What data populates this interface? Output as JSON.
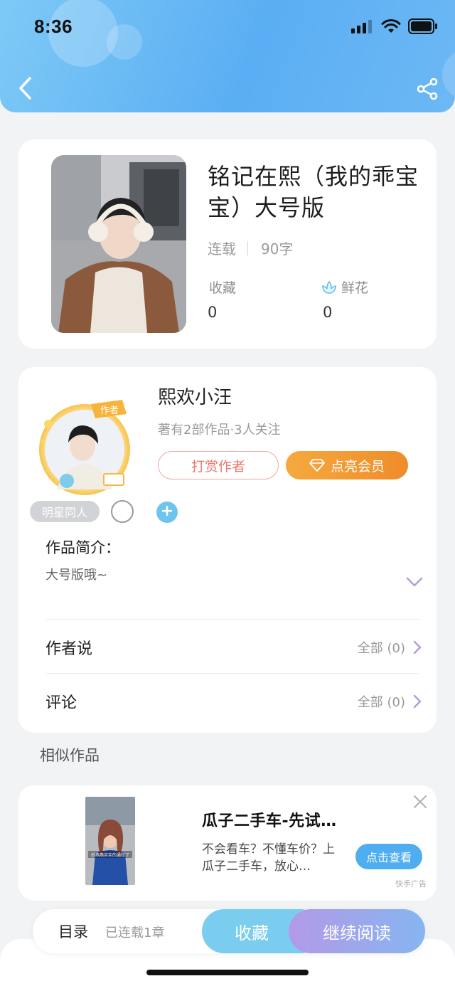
{
  "status_bar": {
    "time": "8:36"
  },
  "book": {
    "title": "铭记在熙（我的乖宝宝）大号版",
    "status": "连载",
    "word_count": "90字",
    "favorites_label": "收藏",
    "favorites_value": "0",
    "flowers_label": "鲜花",
    "flowers_value": "0"
  },
  "author": {
    "name": "熙欢小汪",
    "meta": "著有2部作品·3人关注",
    "badge_text": "作者",
    "tip_button": "打赏作者",
    "vip_button": "点亮会员",
    "tag": "明星同人",
    "tag_add": "+",
    "intro_title": "作品简介：",
    "intro_text": "大号版哦~",
    "author_says_label": "作者说",
    "author_says_right": "全部 (0)",
    "comments_label": "评论",
    "comments_right": "全部 (0)"
  },
  "similar": {
    "title": "相似作品"
  },
  "ad": {
    "title": "瓜子二手车-先试…",
    "description": "不会看车？不懂车价？上瓜子二手车，放心…",
    "button": "点击查看",
    "source": "快手广告",
    "thumb_caption": "抄燕燕实实的通知了"
  },
  "bottom_bar": {
    "toc_label": "目录",
    "toc_count": "已连载1章",
    "collect_button": "收藏",
    "read_button": "继续阅读"
  },
  "colors": {
    "header_gradient_start": "#7ec9f6",
    "header_gradient_end": "#5aaef3",
    "accent_orange": "#ef8c2a",
    "tip_red": "#e8766c",
    "read_gradient_start": "#b29ae8",
    "read_gradient_end": "#86b5f0"
  }
}
